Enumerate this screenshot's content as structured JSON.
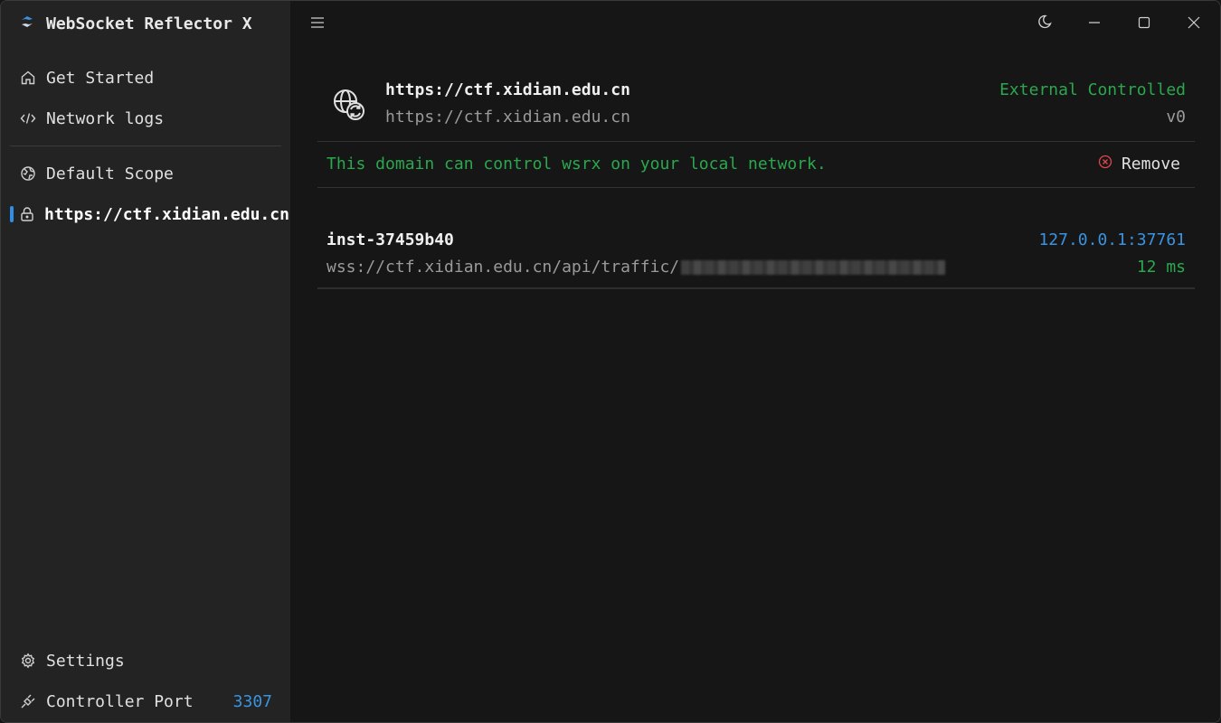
{
  "app": {
    "title": "WebSocket Reflector X"
  },
  "sidebar": {
    "items": [
      {
        "label": "Get Started",
        "icon": "home-icon"
      },
      {
        "label": "Network logs",
        "icon": "code-icon"
      },
      {
        "label": "Default Scope",
        "icon": "globe-icon"
      },
      {
        "label": "https://ctf.xidian.edu.cn",
        "icon": "lock-icon",
        "active": true
      }
    ],
    "settings_label": "Settings",
    "controller_port_label": "Controller Port",
    "controller_port_value": "3307"
  },
  "scope": {
    "title": "https://ctf.xidian.edu.cn",
    "subtitle": "https://ctf.xidian.edu.cn",
    "status": "External Controlled",
    "version": "v0",
    "notice": "This domain can control wsrx on your local network.",
    "remove_label": "Remove"
  },
  "instance": {
    "name": "inst-37459b40",
    "url_prefix": "wss://ctf.xidian.edu.cn/api/traffic/",
    "address": "127.0.0.1:37761",
    "latency": "12 ms"
  },
  "colors": {
    "accent": "#3b93e0",
    "success": "#2aa84e",
    "danger": "#e0474c",
    "sidebar_bg": "#232323",
    "main_bg": "#161616"
  }
}
